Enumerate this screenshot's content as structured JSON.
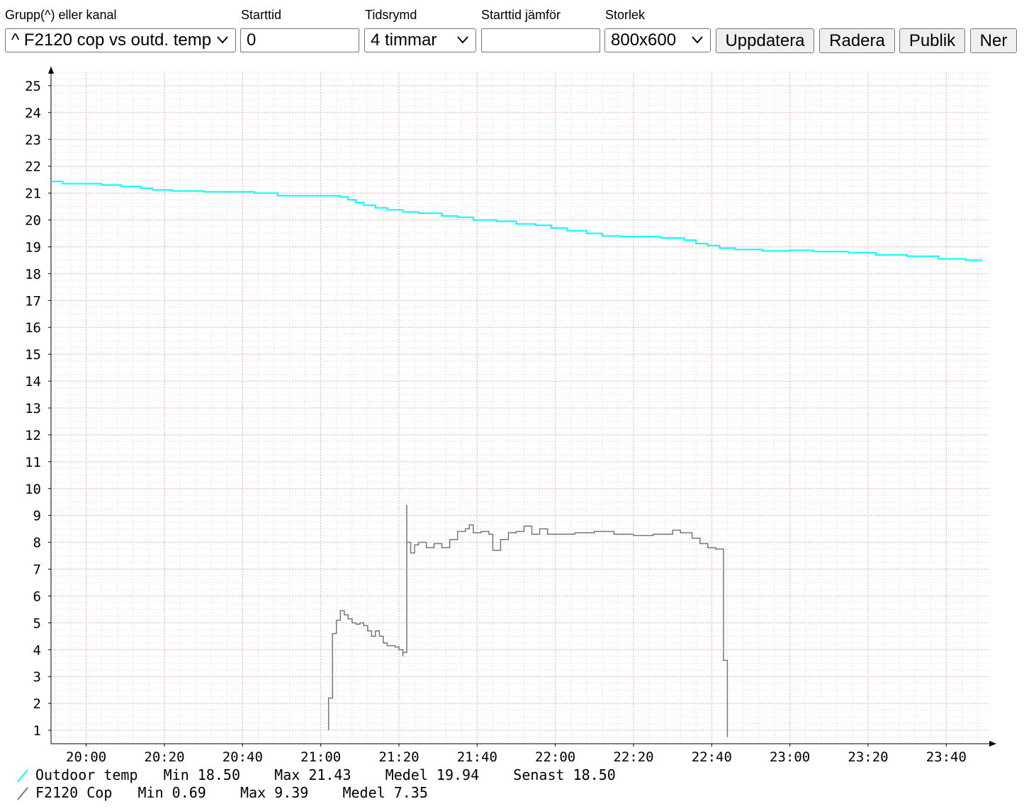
{
  "toolbar": {
    "group_label": "Grupp(^) eller kanal",
    "group_value": "^ F2120 cop vs outd. temp",
    "start_label": "Starttid",
    "start_value": "0",
    "range_label": "Tidsrymd",
    "range_value": "4 timmar",
    "compare_label": "Starttid jämför",
    "compare_value": "",
    "size_label": "Storlek",
    "size_value": "800x600",
    "update_button": "Uppdatera",
    "delete_button": "Radera",
    "public_button": "Publik",
    "down_button": "Ner"
  },
  "chart_data": {
    "type": "line",
    "x_ticks": [
      "20:00",
      "20:20",
      "20:40",
      "21:00",
      "21:20",
      "21:40",
      "22:00",
      "22:20",
      "22:40",
      "23:00",
      "23:20",
      "23:40"
    ],
    "xlim": [
      "19:51",
      "23:51"
    ],
    "y_ticks": [
      1,
      2,
      3,
      4,
      5,
      6,
      7,
      8,
      9,
      10,
      11,
      12,
      13,
      14,
      15,
      16,
      17,
      18,
      19,
      20,
      21,
      22,
      23,
      24,
      25
    ],
    "ylim": [
      0.5,
      25.5
    ],
    "grid": true,
    "series": [
      {
        "name": "Outdoor temp",
        "color": "#00ffff",
        "stats": "Min 18.50    Max 21.43    Medel 19.94    Senast 18.50",
        "points": [
          [
            "19:51",
            21.43
          ],
          [
            "19:54",
            21.35
          ],
          [
            "20:04",
            21.3
          ],
          [
            "20:09",
            21.25
          ],
          [
            "20:14",
            21.18
          ],
          [
            "20:17",
            21.12
          ],
          [
            "20:22",
            21.08
          ],
          [
            "20:30",
            21.05
          ],
          [
            "20:43",
            21.0
          ],
          [
            "20:49",
            20.9
          ],
          [
            "21:05",
            20.85
          ],
          [
            "21:07",
            20.75
          ],
          [
            "21:09",
            20.65
          ],
          [
            "21:11",
            20.55
          ],
          [
            "21:14",
            20.45
          ],
          [
            "21:17",
            20.38
          ],
          [
            "21:21",
            20.3
          ],
          [
            "21:25",
            20.25
          ],
          [
            "21:31",
            20.15
          ],
          [
            "21:35",
            20.1
          ],
          [
            "21:39",
            20.0
          ],
          [
            "21:45",
            19.95
          ],
          [
            "21:50",
            19.85
          ],
          [
            "21:55",
            19.8
          ],
          [
            "21:59",
            19.7
          ],
          [
            "22:03",
            19.6
          ],
          [
            "22:08",
            19.5
          ],
          [
            "22:12",
            19.4
          ],
          [
            "22:17",
            19.38
          ],
          [
            "22:27",
            19.33
          ],
          [
            "22:33",
            19.25
          ],
          [
            "22:36",
            19.12
          ],
          [
            "22:39",
            19.05
          ],
          [
            "22:42",
            18.95
          ],
          [
            "22:46",
            18.9
          ],
          [
            "22:53",
            18.85
          ],
          [
            "23:00",
            18.87
          ],
          [
            "23:06",
            18.82
          ],
          [
            "23:15",
            18.78
          ],
          [
            "23:22",
            18.7
          ],
          [
            "23:30",
            18.65
          ],
          [
            "23:38",
            18.55
          ],
          [
            "23:45",
            18.5
          ],
          [
            "23:49",
            18.48
          ]
        ]
      },
      {
        "name": "F2120 Cop",
        "color": "#777777",
        "stats": "Min 0.69    Max 9.39    Medel 7.35",
        "points": [
          [
            "21:02",
            1.0
          ],
          [
            "21:02",
            2.2
          ],
          [
            "21:03",
            2.5
          ],
          [
            "21:03",
            3.6
          ],
          [
            "21:03",
            4.6
          ],
          [
            "21:04",
            4.7
          ],
          [
            "21:04",
            5.1
          ],
          [
            "21:05",
            5.45
          ],
          [
            "21:06",
            5.3
          ],
          [
            "21:07",
            5.15
          ],
          [
            "21:08",
            5.0
          ],
          [
            "21:09",
            4.95
          ],
          [
            "21:10",
            5.0
          ],
          [
            "21:11",
            4.9
          ],
          [
            "21:12",
            4.7
          ],
          [
            "21:13",
            4.5
          ],
          [
            "21:14",
            4.7
          ],
          [
            "21:15",
            4.5
          ],
          [
            "21:16",
            4.25
          ],
          [
            "21:17",
            4.15
          ],
          [
            "21:18",
            4.15
          ],
          [
            "21:19",
            4.1
          ],
          [
            "21:20",
            4.0
          ],
          [
            "21:21",
            3.75
          ],
          [
            "21:21",
            3.9
          ],
          [
            "21:22",
            6.1
          ],
          [
            "21:22",
            9.39
          ],
          [
            "21:22",
            8.0
          ],
          [
            "21:23",
            7.6
          ],
          [
            "21:24",
            7.9
          ],
          [
            "21:25",
            8.0
          ],
          [
            "21:27",
            7.8
          ],
          [
            "21:29",
            7.95
          ],
          [
            "21:31",
            7.8
          ],
          [
            "21:33",
            8.1
          ],
          [
            "21:35",
            8.4
          ],
          [
            "21:37",
            8.5
          ],
          [
            "21:38",
            8.65
          ],
          [
            "21:39",
            8.35
          ],
          [
            "21:41",
            8.4
          ],
          [
            "21:43",
            8.3
          ],
          [
            "21:44",
            7.7
          ],
          [
            "21:46",
            8.1
          ],
          [
            "21:48",
            8.35
          ],
          [
            "21:50",
            8.4
          ],
          [
            "21:52",
            8.6
          ],
          [
            "21:54",
            8.3
          ],
          [
            "21:56",
            8.5
          ],
          [
            "21:58",
            8.3
          ],
          [
            "22:00",
            8.3
          ],
          [
            "22:05",
            8.35
          ],
          [
            "22:10",
            8.4
          ],
          [
            "22:15",
            8.3
          ],
          [
            "22:20",
            8.25
          ],
          [
            "22:25",
            8.3
          ],
          [
            "22:30",
            8.45
          ],
          [
            "22:32",
            8.35
          ],
          [
            "22:35",
            8.15
          ],
          [
            "22:37",
            7.95
          ],
          [
            "22:39",
            7.8
          ],
          [
            "22:41",
            7.75
          ],
          [
            "22:43",
            5.8
          ],
          [
            "22:43",
            3.6
          ],
          [
            "22:44",
            0.75
          ]
        ]
      }
    ]
  }
}
